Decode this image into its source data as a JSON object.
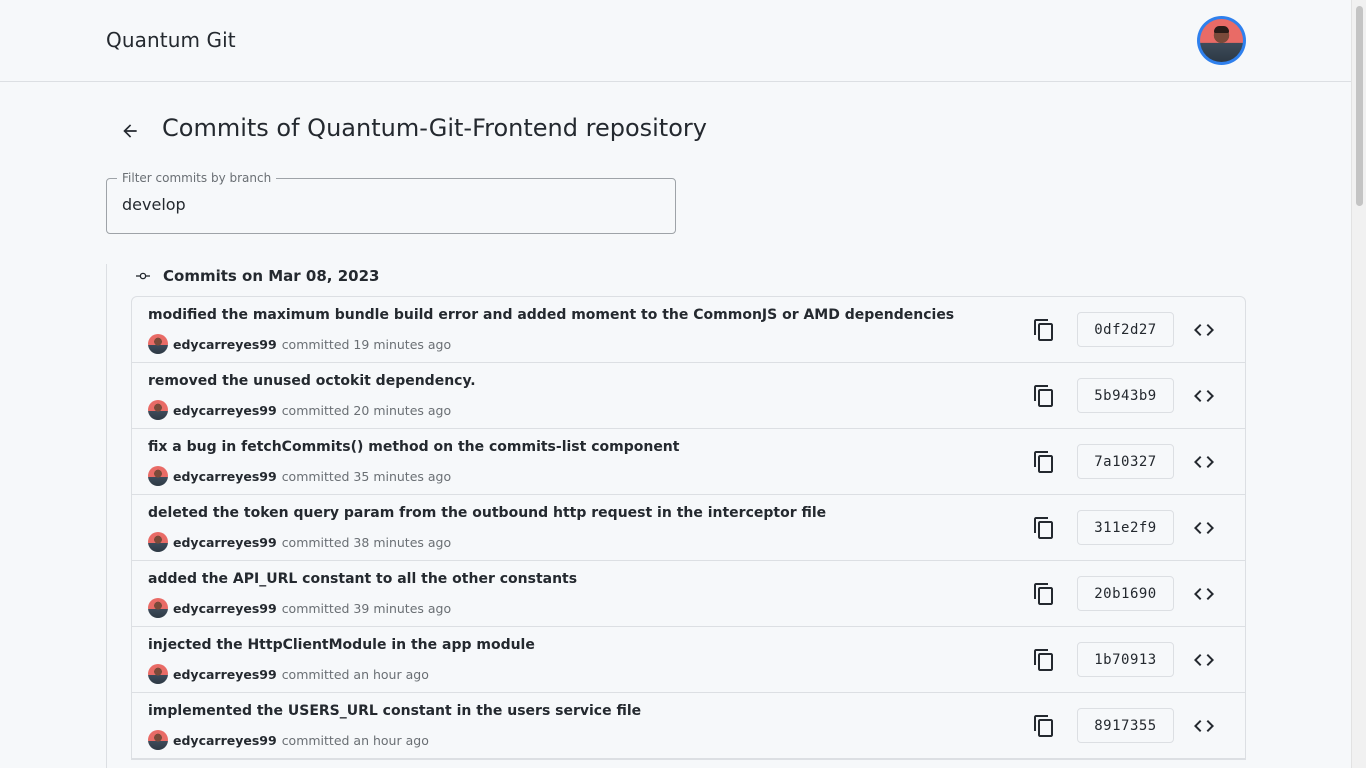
{
  "app": {
    "title": "Quantum Git"
  },
  "page": {
    "title": "Commits of Quantum-Git-Frontend repository"
  },
  "filter": {
    "label": "Filter commits by branch",
    "value": "develop"
  },
  "group": {
    "title": "Commits on Mar 08, 2023"
  },
  "commits": [
    {
      "message": "modified the maximum bundle build error and added moment to the CommonJS or AMD dependencies",
      "author": "edycarreyes99",
      "time": "committed 19 minutes ago",
      "sha": "0df2d27"
    },
    {
      "message": "removed the unused octokit dependency.",
      "author": "edycarreyes99",
      "time": "committed 20 minutes ago",
      "sha": "5b943b9"
    },
    {
      "message": "fix a bug in fetchCommits() method on the commits-list component",
      "author": "edycarreyes99",
      "time": "committed 35 minutes ago",
      "sha": "7a10327"
    },
    {
      "message": "deleted the token query param from the outbound http request in the interceptor file",
      "author": "edycarreyes99",
      "time": "committed 38 minutes ago",
      "sha": "311e2f9"
    },
    {
      "message": "added the API_URL constant to all the other constants",
      "author": "edycarreyes99",
      "time": "committed 39 minutes ago",
      "sha": "20b1690"
    },
    {
      "message": "injected the HttpClientModule in the app module",
      "author": "edycarreyes99",
      "time": "committed an hour ago",
      "sha": "1b70913"
    },
    {
      "message": "implemented the USERS_URL constant in the users service file",
      "author": "edycarreyes99",
      "time": "committed an hour ago",
      "sha": "8917355"
    }
  ],
  "icons": {
    "back": "arrow-left-icon",
    "commit": "git-commit-icon",
    "copy": "copy-icon",
    "code": "code-icon"
  },
  "colors": {
    "background": "#f6f8fa",
    "border": "#dcdfe3",
    "text": "#24292f",
    "muted": "#6a6f74",
    "avatar_ring": "#2f80ed"
  }
}
